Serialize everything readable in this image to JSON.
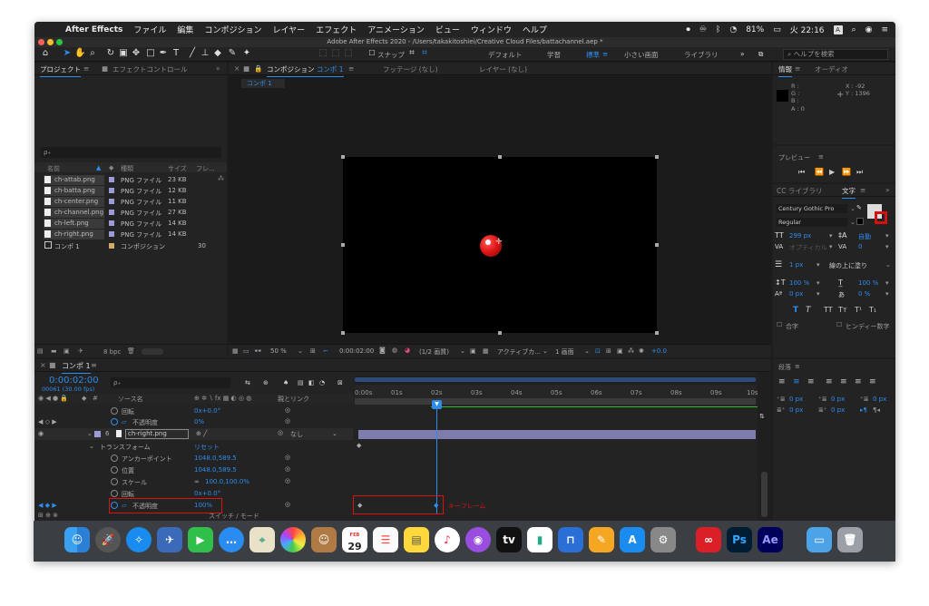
{
  "menubar": {
    "apple": "",
    "app": "After Effects",
    "items": [
      "ファイル",
      "編集",
      "コンポジション",
      "レイヤー",
      "エフェクト",
      "アニメーション",
      "ビュー",
      "ウィンドウ",
      "ヘルプ"
    ],
    "battery": "81%",
    "clock": "火 22:16",
    "input_badge": "A"
  },
  "title": "Adobe After Effects 2020 - /Users/takakitoshiei/Creative Cloud Files/battachannel.aep *",
  "toolbar": {
    "snap_label": "スナップ",
    "workspaces": [
      "デフォルト",
      "学習",
      "標準",
      "小さい画面",
      "ライブラリ"
    ],
    "active_workspace": "標準",
    "help_search_placeholder": "ヘルプを検索"
  },
  "project_panel": {
    "tab_project": "プロジェクト",
    "tab_effects": "エフェクトコントロール",
    "search_placeholder": "ρ₊",
    "columns": {
      "name": "名前",
      "type": "種類",
      "size": "サイズ",
      "frame": "フレ..."
    },
    "rows": [
      {
        "name": "ch-attab.png",
        "type": "PNG ファイル",
        "size": "23 KB"
      },
      {
        "name": "ch-batta.png",
        "type": "PNG ファイル",
        "size": "12 KB"
      },
      {
        "name": "ch-center.png",
        "type": "PNG ファイル",
        "size": "11 KB"
      },
      {
        "name": "ch-channel.png",
        "type": "PNG ファイル",
        "size": "27 KB"
      },
      {
        "name": "ch-left.png",
        "type": "PNG ファイル",
        "size": "14 KB"
      },
      {
        "name": "ch-right.png",
        "type": "PNG ファイル",
        "size": "14 KB"
      }
    ],
    "comp_row": {
      "name": "コンポ 1",
      "type": "コンポジション",
      "frame": "30"
    },
    "bpc": "8 bpc"
  },
  "comp_panel": {
    "tab_comp": "コンポジション",
    "tab_comp_name": "コンポ 1",
    "tab_footage": "フッテージ (なし)",
    "tab_layer": "レイヤー (なし)",
    "breadcrumb": "コンポ 1",
    "zoom": "50 %",
    "timecode": "0:00:02:00",
    "resolution": "(1/2 画質)",
    "camera": "アクティブカ...",
    "views": "1 画面",
    "exposure": "+0.0"
  },
  "info_panel": {
    "tab_info": "情報",
    "tab_audio": "オーディオ",
    "r": "R :",
    "g": "G :",
    "b": "B :",
    "a": "A : 0",
    "x": "X : -92",
    "y": "Y : 1396"
  },
  "preview_panel": {
    "title": "プレビュー"
  },
  "char_panel": {
    "tab_cc": "CC ライブラリ",
    "tab_char": "文字",
    "font": "Century Gothic Pro",
    "style": "Regular",
    "size": "299 px",
    "leading": "自動",
    "kerning": "オプティカル",
    "tracking": "0",
    "stroke": "1 px",
    "stroke_mode": "線の上に塗り",
    "vscale": "100 %",
    "hscale": "100 %",
    "baseline": "0 px",
    "tsume": "0 %",
    "ligature": "合字",
    "hindi": "ヒンディー数字"
  },
  "para_panel": {
    "title": "段落",
    "v1": "0 px",
    "v2": "0 px",
    "v3": "0 px",
    "v4": "0 px",
    "v5": "0 px"
  },
  "timeline": {
    "tab": "コンポ 1",
    "timecode": "0:00:02:00",
    "frames": "00061 (30.00 fps)",
    "col_source": "ソース名",
    "col_parent": "親とリンク",
    "ruler": [
      "0:00s",
      "01s",
      "02s",
      "03s",
      "04s",
      "05s",
      "06s",
      "07s",
      "08s",
      "09s",
      "10s"
    ],
    "rot1_label": "回転",
    "rot1_value": "0x+0.0°",
    "opac1_label": "不透明度",
    "opac1_value": "0%",
    "layer_num": "6",
    "layer_name": "ch-right.png",
    "layer_parent": "なし",
    "transform_label": "トランスフォーム",
    "reset_label": "リセット",
    "anchor_label": "アンカーポイント",
    "anchor_value": "1048.0,589.5",
    "position_label": "位置",
    "position_value": "1048.0,589.5",
    "scale_label": "スケール",
    "scale_value": "100.0,100.0%",
    "rot2_label": "回転",
    "rot2_value": "0x+0.0°",
    "opac2_label": "不透明度",
    "opac2_value": "100%",
    "switch_mode": "スイッチ / モード",
    "keyframe_annotation": "キーフレーム"
  },
  "dock": {
    "calendar_month": "FEB",
    "calendar_day": "29",
    "ps": "Ps",
    "ae": "Ae"
  }
}
